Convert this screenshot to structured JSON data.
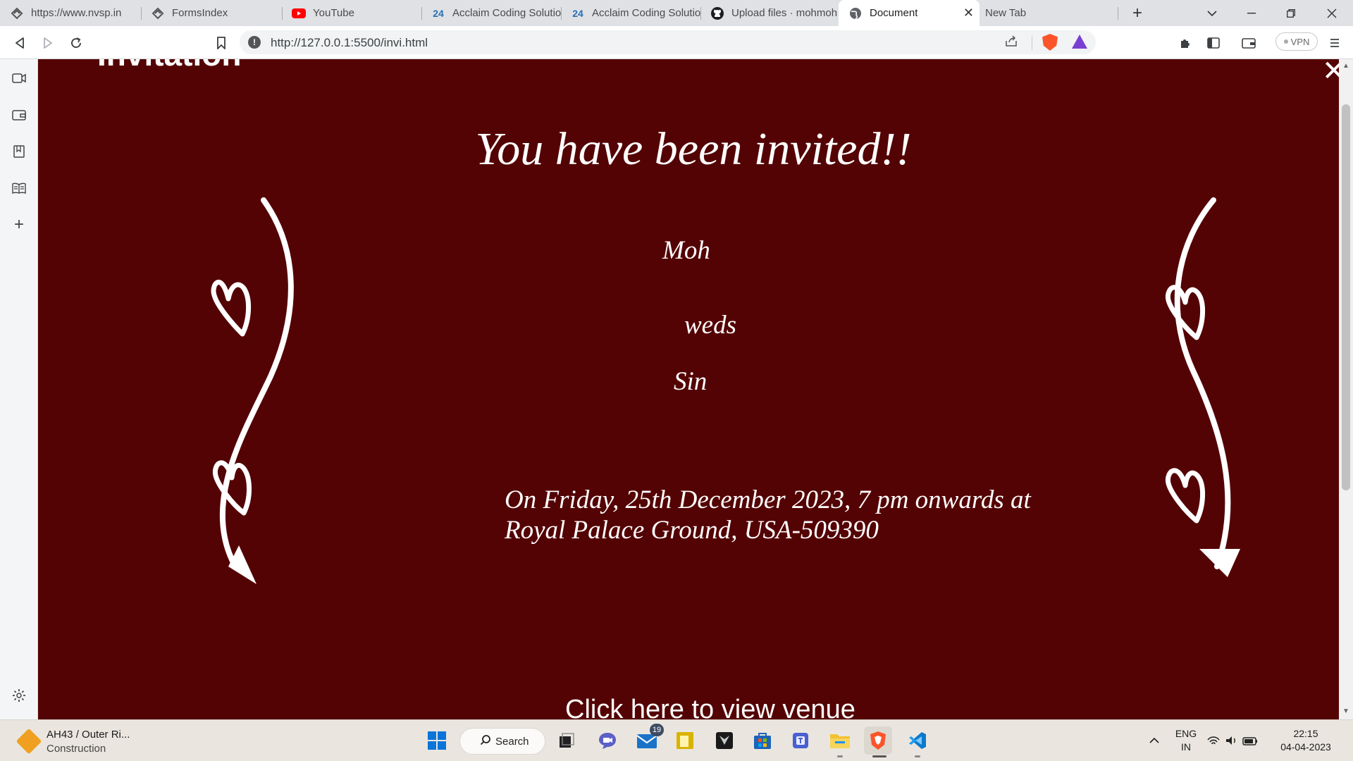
{
  "browser": {
    "tabs": [
      {
        "title": "https://www.nvsp.in",
        "icon": "nvsp-logo-icon",
        "active": false
      },
      {
        "title": "FormsIndex",
        "icon": "nvsp-logo-icon",
        "active": false
      },
      {
        "title": "YouTube",
        "icon": "youtube-icon",
        "active": false
      },
      {
        "title": "Acclaim Coding Solutio",
        "icon": "acclaim-24-icon",
        "icon_text": "24",
        "active": false
      },
      {
        "title": "Acclaim Coding Solutio",
        "icon": "acclaim-24-icon",
        "icon_text": "24",
        "active": false
      },
      {
        "title": "Upload files · mohmoh",
        "icon": "github-icon",
        "active": false
      },
      {
        "title": "Document",
        "icon": "globe-icon",
        "active": true
      },
      {
        "title": "New Tab",
        "icon": "",
        "active": false
      }
    ],
    "url": "http://127.0.0.1:5500/invi.html",
    "vpn_label": "VPN"
  },
  "page": {
    "heading_partial": "Invitation",
    "invited_text": "You have been invited!!",
    "name_1": "Moh",
    "weds": "weds",
    "name_2": "Sin",
    "details_line_1": "On Friday, 25th December 2023, 7 pm onwards at",
    "details_line_2": "Royal Palace Ground, USA-509390",
    "venue_link": "Click here to view venue",
    "close_symbol": "✕",
    "background_color": "#540304",
    "text_color": "#ffffff"
  },
  "taskbar": {
    "weather_title": "AH43 / Outer Ri...",
    "weather_subtitle": "Construction",
    "search_label": "Search",
    "mail_badge": "19",
    "lang_1": "ENG",
    "lang_2": "IN",
    "time": "22:15",
    "date": "04-04-2023"
  }
}
